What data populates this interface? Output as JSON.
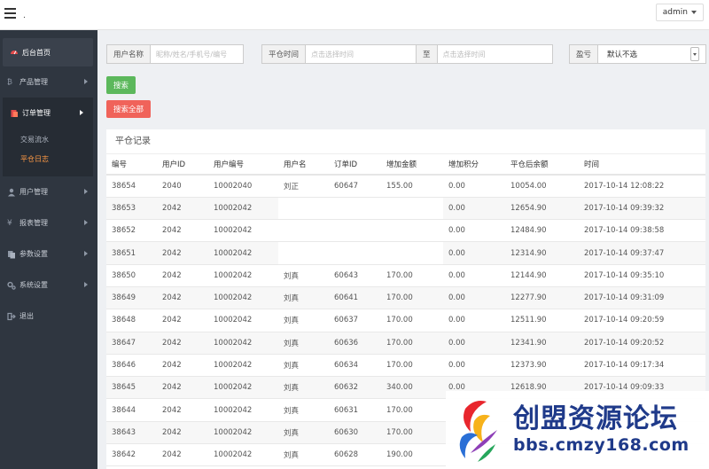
{
  "header": {
    "dot": ".",
    "user": "admin"
  },
  "sidebar": {
    "items": [
      {
        "label": "后台首页",
        "icon": "dashboard-icon"
      },
      {
        "label": "产品管理",
        "icon": "bitcoin-icon"
      },
      {
        "label": "订单管理",
        "icon": "file-icon"
      },
      {
        "label": "用户管理",
        "icon": "user-icon"
      },
      {
        "label": "报表管理",
        "icon": "yen-icon"
      },
      {
        "label": "参数设置",
        "icon": "copy-icon"
      },
      {
        "label": "系统设置",
        "icon": "gears-icon"
      },
      {
        "label": "退出",
        "icon": "logout-icon"
      }
    ],
    "sub_items": [
      {
        "label": "交易流水"
      },
      {
        "label": "平仓日志"
      }
    ]
  },
  "filters": {
    "user_label": "用户名称",
    "user_placeholder": "昵称/姓名/手机号/编号",
    "time_label": "平仓时间",
    "time_start_placeholder": "点击选择时间",
    "to_label": "至",
    "time_end_placeholder": "点击选择时间",
    "pl_label": "盈亏",
    "pl_value": "默认不选"
  },
  "buttons": {
    "search": "搜索",
    "search_all": "搜索全部"
  },
  "panel": {
    "title": "平仓记录",
    "columns": [
      "编号",
      "用户ID",
      "用户编号",
      "用户名",
      "订单ID",
      "增加金额",
      "增加积分",
      "平仓后余额",
      "时间"
    ],
    "rows": [
      [
        "38654",
        "2040",
        "10002040",
        "刘正",
        "60647",
        "155.00",
        "0.00",
        "10054.00",
        "2017-10-14 12:08:22"
      ],
      [
        "38653",
        "2042",
        "10002042",
        "",
        "",
        "",
        "0.00",
        "12654.90",
        "2017-10-14 09:39:32"
      ],
      [
        "38652",
        "2042",
        "10002042",
        "",
        "",
        "",
        "0.00",
        "12484.90",
        "2017-10-14 09:38:58"
      ],
      [
        "38651",
        "2042",
        "10002042",
        "",
        "",
        "",
        "0.00",
        "12314.90",
        "2017-10-14 09:37:47"
      ],
      [
        "38650",
        "2042",
        "10002042",
        "刘真",
        "60643",
        "170.00",
        "0.00",
        "12144.90",
        "2017-10-14 09:35:10"
      ],
      [
        "38649",
        "2042",
        "10002042",
        "刘真",
        "60641",
        "170.00",
        "0.00",
        "12277.90",
        "2017-10-14 09:31:09"
      ],
      [
        "38648",
        "2042",
        "10002042",
        "刘真",
        "60637",
        "170.00",
        "0.00",
        "12511.90",
        "2017-10-14 09:20:59"
      ],
      [
        "38647",
        "2042",
        "10002042",
        "刘真",
        "60636",
        "170.00",
        "0.00",
        "12341.90",
        "2017-10-14 09:20:52"
      ],
      [
        "38646",
        "2042",
        "10002042",
        "刘真",
        "60634",
        "170.00",
        "0.00",
        "12373.90",
        "2017-10-14 09:17:34"
      ],
      [
        "38645",
        "2042",
        "10002042",
        "刘真",
        "60632",
        "340.00",
        "0.00",
        "12618.90",
        "2017-10-14 09:09:33"
      ],
      [
        "38644",
        "2042",
        "10002042",
        "刘真",
        "60631",
        "170.00",
        "",
        "",
        ""
      ],
      [
        "38643",
        "2042",
        "10002042",
        "刘真",
        "60630",
        "170.00",
        "",
        "",
        ""
      ],
      [
        "38642",
        "2042",
        "10002042",
        "刘真",
        "60628",
        "190.00",
        "",
        "",
        ""
      ]
    ]
  },
  "watermark": {
    "name": "创盟资源论坛",
    "url": "bbs.cmzy168.com"
  }
}
